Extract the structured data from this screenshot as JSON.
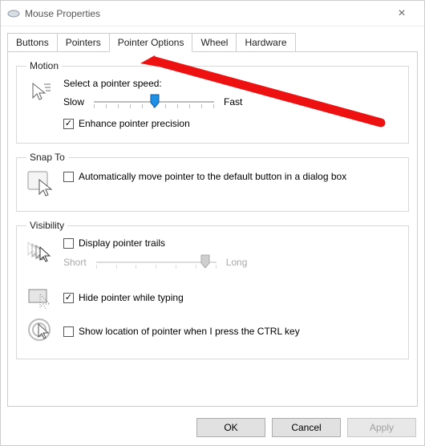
{
  "window": {
    "title": "Mouse Properties"
  },
  "tabs": {
    "items": [
      {
        "label": "Buttons"
      },
      {
        "label": "Pointers"
      },
      {
        "label": "Pointer Options"
      },
      {
        "label": "Wheel"
      },
      {
        "label": "Hardware"
      }
    ],
    "active": 2
  },
  "motion": {
    "legend": "Motion",
    "speed_label": "Select a pointer speed:",
    "slow": "Slow",
    "fast": "Fast",
    "enhance_label": "Enhance pointer precision",
    "enhance_checked": true,
    "speed_value": 6
  },
  "snap": {
    "legend": "Snap To",
    "auto_label": "Automatically move pointer to the default button in a dialog box",
    "auto_checked": false
  },
  "visibility": {
    "legend": "Visibility",
    "trails_label": "Display pointer trails",
    "trails_checked": false,
    "short": "Short",
    "long": "Long",
    "hide_label": "Hide pointer while typing",
    "hide_checked": true,
    "ctrl_label": "Show location of pointer when I press the CTRL key",
    "ctrl_checked": false
  },
  "buttons": {
    "ok": "OK",
    "cancel": "Cancel",
    "apply": "Apply"
  }
}
